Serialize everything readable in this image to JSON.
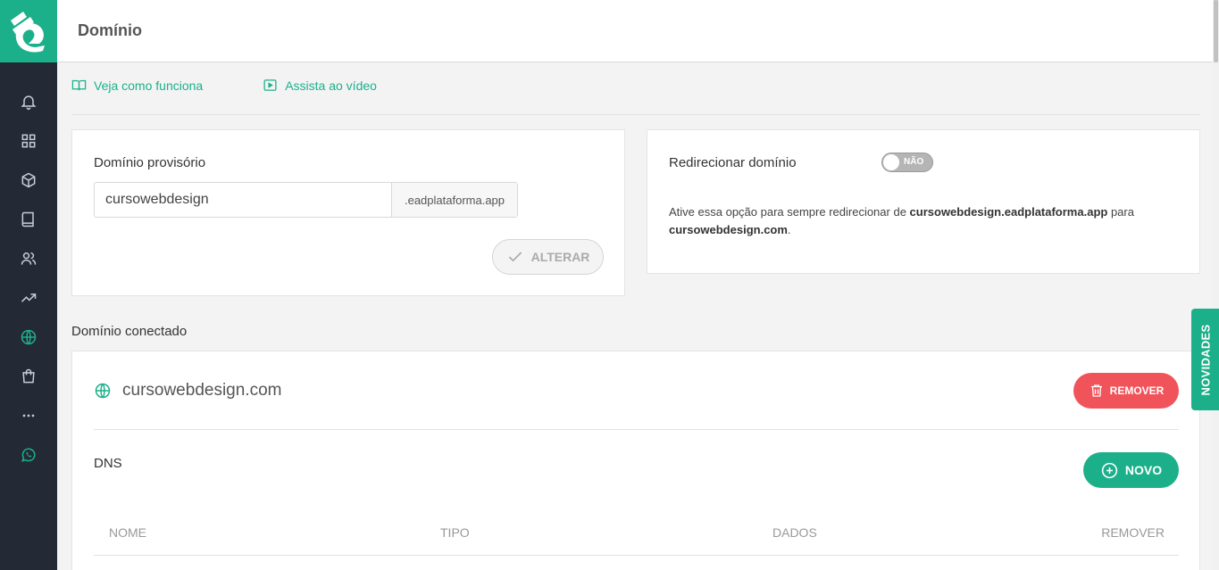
{
  "header": {
    "title": "Domínio"
  },
  "help_links": [
    {
      "label": "Veja como funciona",
      "icon": "book-icon"
    },
    {
      "label": "Assista ao vídeo",
      "icon": "video-icon"
    }
  ],
  "temp_domain": {
    "label": "Domínio provisório",
    "value": "cursowebdesign",
    "suffix": ".eadplataforma.app",
    "button_label": "ALTERAR"
  },
  "redirect": {
    "label": "Redirecionar domínio",
    "toggle_text": "NÃO",
    "toggle_on": false,
    "desc_prefix": "Ative essa opção para sempre redirecionar de ",
    "desc_from": "cursowebdesign.eadplataforma.app",
    "desc_middle": " para ",
    "desc_to": "cursowebdesign.com",
    "desc_suffix": "."
  },
  "connected": {
    "section_title": "Domínio conectado",
    "domain": "cursowebdesign.com",
    "remove_label": "REMOVER",
    "dns_title": "DNS",
    "new_label": "NOVO",
    "columns": {
      "name": "NOME",
      "type": "TIPO",
      "data": "DADOS",
      "remove": "REMOVER"
    }
  },
  "side_tab": {
    "label": "NOVIDADES"
  },
  "colors": {
    "brand": "#1cb08a",
    "sidebar": "#232a36",
    "danger": "#f0545a"
  }
}
